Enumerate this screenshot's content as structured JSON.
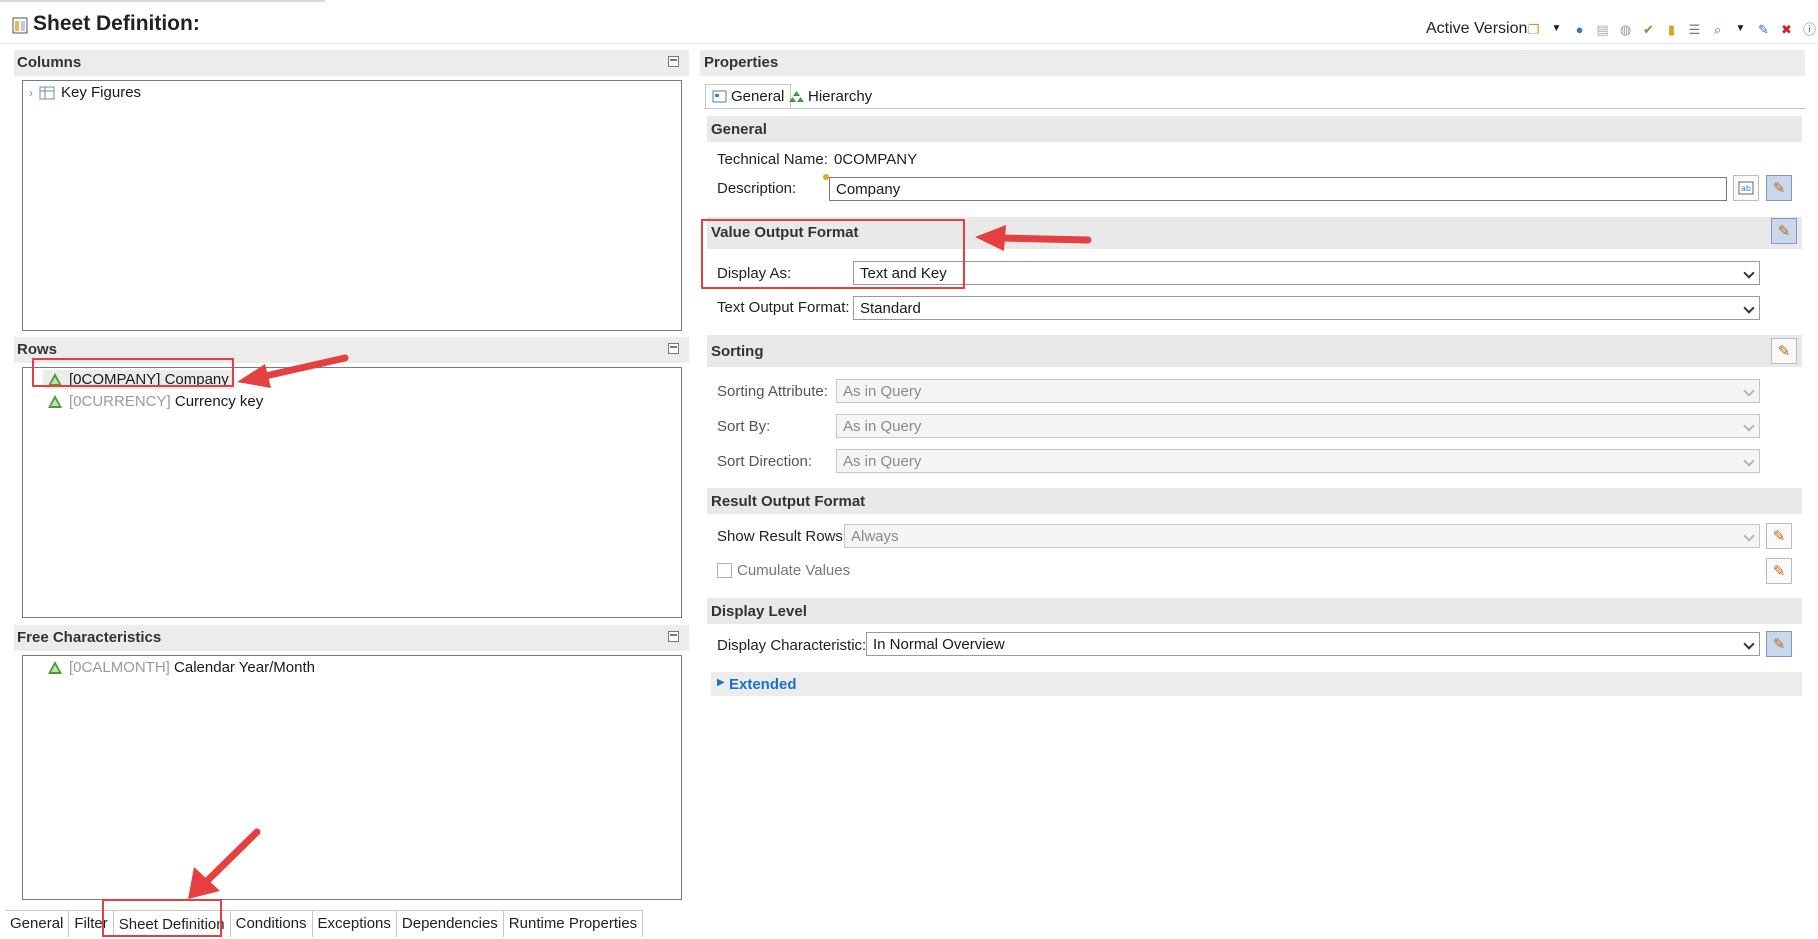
{
  "header": {
    "title": "Sheet Definition:",
    "active_version": "Active Version"
  },
  "panes": {
    "columns": {
      "title": "Columns",
      "items": [
        {
          "label": "Key Figures"
        }
      ]
    },
    "rows": {
      "title": "Rows",
      "items": [
        {
          "tech": "[0COMPANY]",
          "label": "Company",
          "selected": true
        },
        {
          "tech": "[0CURRENCY]",
          "label": "Currency key"
        }
      ]
    },
    "free_characteristics": {
      "title": "Free Characteristics",
      "items": [
        {
          "tech": "[0CALMONTH]",
          "label": "Calendar Year/Month"
        }
      ]
    }
  },
  "properties": {
    "title": "Properties",
    "tabs": [
      {
        "label": "General",
        "active": true
      },
      {
        "label": "Hierarchy"
      }
    ],
    "general": {
      "title": "General",
      "technical_name_label": "Technical Name:",
      "technical_name_value": "0COMPANY",
      "description_label": "Description:",
      "description_value": "Company"
    },
    "value_output_format": {
      "title": "Value Output Format",
      "display_as_label": "Display As:",
      "display_as_value": "Text and Key",
      "text_output_format_label": "Text Output Format:",
      "text_output_format_value": "Standard"
    },
    "sorting": {
      "title": "Sorting",
      "sorting_attribute_label": "Sorting Attribute:",
      "sorting_attribute_value": "As in Query",
      "sort_by_label": "Sort By:",
      "sort_by_value": "As in Query",
      "sort_direction_label": "Sort Direction:",
      "sort_direction_value": "As in Query"
    },
    "result_output_format": {
      "title": "Result Output Format",
      "show_result_rows_label": "Show Result Rows:",
      "show_result_rows_value": "Always",
      "cumulate_values_label": "Cumulate Values"
    },
    "display_level": {
      "title": "Display Level",
      "display_characteristic_label": "Display Characteristic:",
      "display_characteristic_value": "In Normal Overview"
    },
    "extended": {
      "label": "Extended"
    }
  },
  "bottom_tabs": [
    {
      "label": "General"
    },
    {
      "label": "Filter"
    },
    {
      "label": "Sheet Definition",
      "active": true
    },
    {
      "label": "Conditions"
    },
    {
      "label": "Exceptions"
    },
    {
      "label": "Dependencies"
    },
    {
      "label": "Runtime Properties"
    }
  ],
  "colors": {
    "accent_blue": "#1a73c8",
    "annotation_red": "#e5403f",
    "section_bg": "#e9e9e9"
  }
}
